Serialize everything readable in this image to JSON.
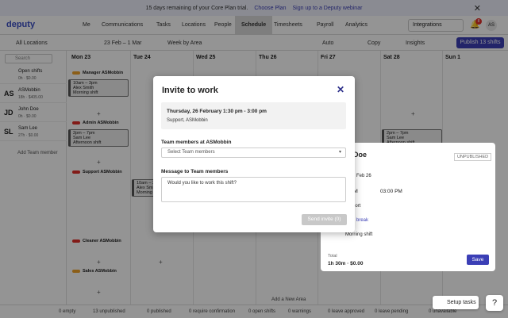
{
  "banner": {
    "text": "15 days remaining of your Core Plan trial.",
    "link1": "Choose Plan",
    "link2": "Sign up to a Deputy webinar",
    "close": "✕"
  },
  "nav": {
    "logo": "deputy",
    "items": [
      "Me",
      "Communications",
      "Tasks",
      "Locations",
      "People",
      "Schedule",
      "Timesheets",
      "Payroll",
      "Analytics"
    ],
    "integrations": "Integrations",
    "badge": "8",
    "avatar": "AS"
  },
  "toolbar": {
    "location": "All Locations",
    "date_range": "23 Feb – 1 Mar",
    "view": "Week by Area",
    "auto": "Auto",
    "copy": "Copy",
    "insights": "Insights",
    "publish": "Publish 13 shifts"
  },
  "search": {
    "placeholder": "Search"
  },
  "people": [
    {
      "init": "",
      "name": "Open shifts",
      "sub": "0h · $0.00"
    },
    {
      "init": "AS",
      "name": "ASMobbin",
      "sub": "18h · $405.00"
    },
    {
      "init": "JD",
      "name": "John Doe",
      "sub": "0h · $0.00"
    },
    {
      "init": "SL",
      "name": "Sam Lee",
      "sub": "27h · $0.00"
    }
  ],
  "add_member": "Add Team member",
  "days": [
    "Mon 23",
    "Tue 24",
    "Wed 25",
    "Thu 26",
    "Fri 27",
    "Sat 28",
    "Sun 1"
  ],
  "areas": [
    {
      "name": "Manager",
      "org": "ASMobbin",
      "color": "#f0a32a"
    },
    {
      "name": "Admin",
      "org": "ASMobbin",
      "color": "#e0302a"
    },
    {
      "name": "Support",
      "org": "ASMobbin",
      "color": "#e0302a"
    },
    {
      "name": "Cleaner",
      "org": "ASMobbin",
      "color": "#e0302a"
    },
    {
      "name": "Sales",
      "org": "ASMobbin",
      "color": "#f0a32a"
    }
  ],
  "shifts": {
    "s1": {
      "time": "10am – 3pm",
      "who": "Alex Smith",
      "note": "Morning shift"
    },
    "s2": {
      "time": "2pm – 7pm",
      "who": "Sam Lee",
      "note": "Afternoon shift"
    },
    "s3": {
      "time": "2pm – 7pm",
      "who": "Sam Lee",
      "note": "Afternoon shift"
    },
    "s4": {
      "time": "10am – 3pm",
      "who": "Alex Smith",
      "note": "Morning shift"
    }
  },
  "footer": [
    "0 empty",
    "13 unpublished",
    "0 published",
    "0 require confirmation",
    "0 open shifts",
    "0 warnings",
    "0 leave approved",
    "0 leave pending",
    "0 unavailable"
  ],
  "add_area": "Add a New Area",
  "modal": {
    "title": "Invite to work",
    "close": "✕",
    "info_line1": "Thursday, 26 February 1:30 pm - 3:00 pm",
    "info_line2": "Support, ASMobbin",
    "team_label": "Team members at ASMobbin",
    "team_placeholder": "Select Team members",
    "message_label": "Message to Team members",
    "message_value": "Would you like to work this shift?",
    "send": "Send invite (0)"
  },
  "drawer": {
    "name": "n Doe",
    "status": "UNPUBLISHED",
    "date": "Feb 26",
    "start": "PM",
    "end": "03:00 PM",
    "area": "port",
    "break": "break",
    "note": "Morning shift",
    "total_label": "Total",
    "total": "1h 30m · $0.00",
    "save": "Save"
  },
  "setup": "Setup tasks",
  "help": "?"
}
